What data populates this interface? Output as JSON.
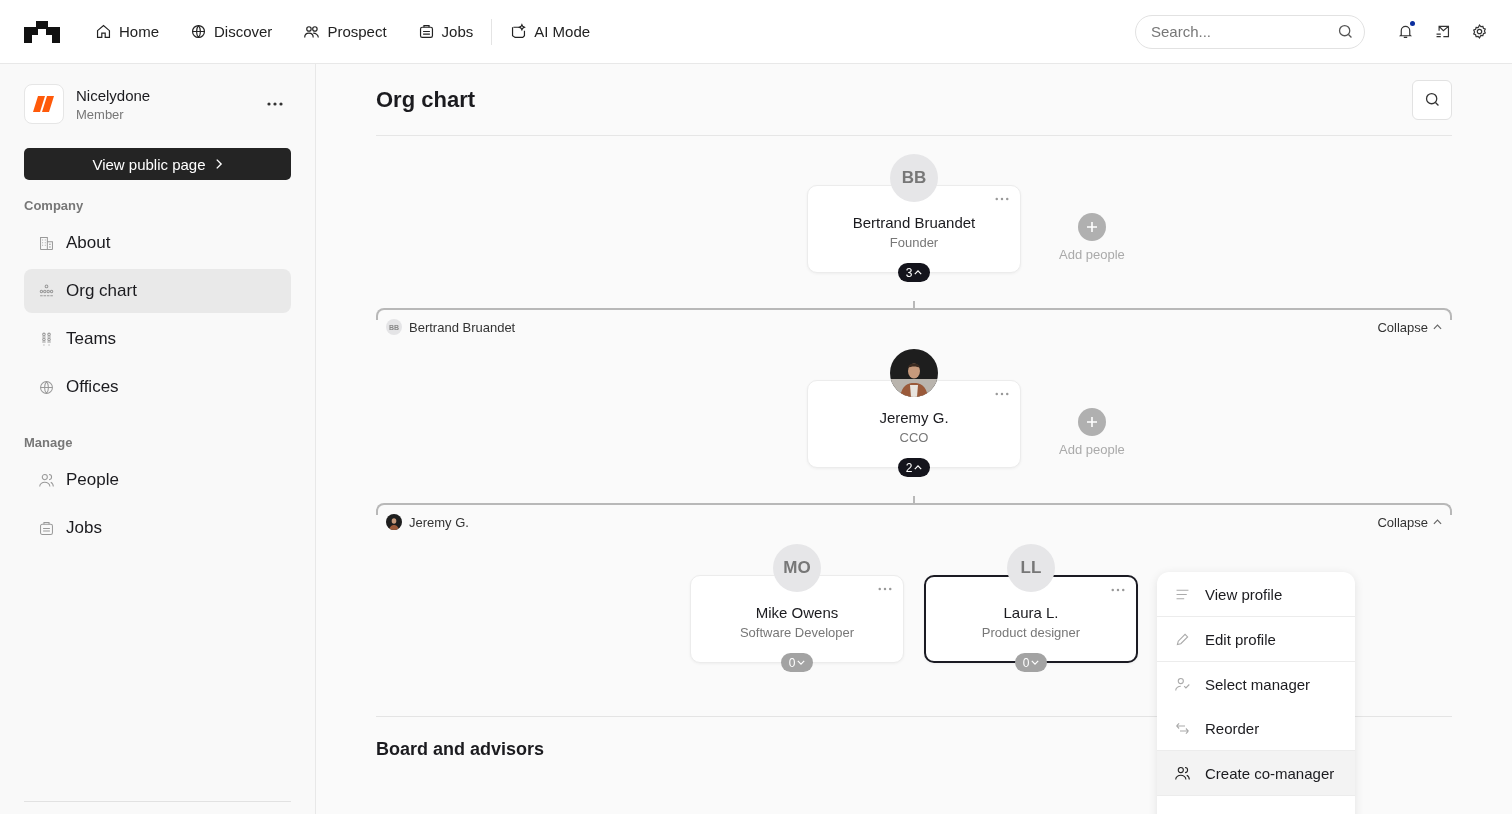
{
  "nav": {
    "items": [
      {
        "label": "Home",
        "selected": false
      },
      {
        "label": "Discover",
        "selected": false
      },
      {
        "label": "Prospect",
        "selected": false
      },
      {
        "label": "Jobs",
        "selected": false
      },
      {
        "label": "AI Mode",
        "selected": false
      }
    ],
    "search": {
      "placeholder": "Search..."
    },
    "notifications": {
      "unread": true
    }
  },
  "sidebar": {
    "org": {
      "name": "Nicelydone",
      "role": "Member"
    },
    "view_button": "View public page",
    "sections": [
      {
        "title": "Company",
        "items": [
          {
            "label": "About",
            "selected": false
          },
          {
            "label": "Org chart",
            "selected": true
          },
          {
            "label": "Teams",
            "selected": false
          },
          {
            "label": "Offices",
            "selected": false
          }
        ]
      },
      {
        "title": "Manage",
        "items": [
          {
            "label": "People",
            "selected": false
          },
          {
            "label": "Jobs",
            "selected": false
          }
        ]
      }
    ]
  },
  "main": {
    "title": "Org chart",
    "rows": [
      {
        "add_label": "Add people",
        "nodes": [
          {
            "initials": "BB",
            "name": "Bertrand Bruandet",
            "role": "Founder",
            "count": "3",
            "expanded": true,
            "selected": false
          }
        ],
        "group": {
          "initials": "BB",
          "label": "Bertrand Bruandet",
          "collapse": "Collapse"
        }
      },
      {
        "add_label": "Add people",
        "nodes": [
          {
            "kind": "picture",
            "name": "Jeremy G.",
            "role": "CCO",
            "count": "2",
            "expanded": true,
            "selected": false
          }
        ],
        "group": {
          "kind": "picture",
          "label": "Jeremy G.",
          "collapse": "Collapse"
        }
      },
      {
        "nodes": [
          {
            "initials": "MO",
            "name": "Mike Owens",
            "role": "Software Developer",
            "count": "0",
            "expanded": false,
            "selected": false
          },
          {
            "initials": "LL",
            "name": "Laura L.",
            "role": "Product designer",
            "count": "0",
            "expanded": false,
            "selected": true
          }
        ]
      }
    ],
    "section_title": "Board and advisors"
  },
  "menu": {
    "items": [
      {
        "label": "View profile",
        "highlighted": false,
        "divider_after": true
      },
      {
        "label": "Edit profile",
        "highlighted": false,
        "divider_after": true
      },
      {
        "label": "Select manager",
        "highlighted": false,
        "divider_after": false
      },
      {
        "label": "Reorder",
        "highlighted": false,
        "divider_after": true
      },
      {
        "label": "Create co-manager",
        "highlighted": true,
        "divider_after": true
      }
    ]
  }
}
